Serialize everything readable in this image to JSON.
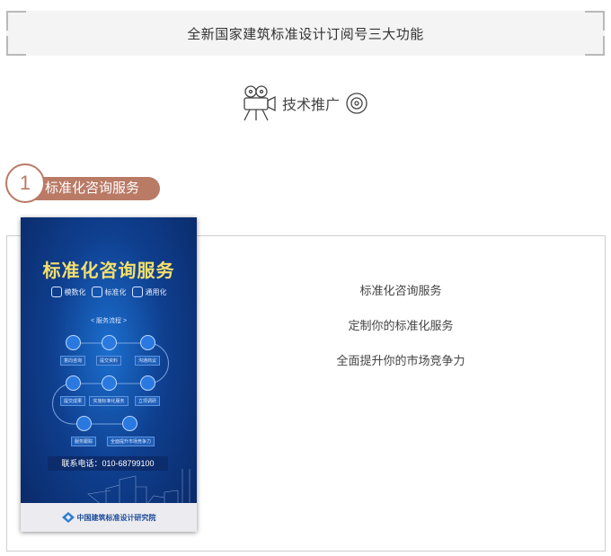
{
  "banner": {
    "title": "全新国家建筑标准设计订阅号三大功能"
  },
  "promo": {
    "label": "技术推广",
    "left_icon": "film-camera-icon",
    "right_icon": "disc-icon"
  },
  "section": {
    "number": "1",
    "title": "标准化咨询服务"
  },
  "card": {
    "lines": [
      "标准化咨询服务",
      "定制你的标准化服务",
      "全面提升你的市场竞争力"
    ]
  },
  "poster": {
    "title": "标准化咨询服务",
    "tags": [
      "模数化",
      "标准化",
      "通用化"
    ],
    "flow_label": "< 服务流程 >",
    "steps": [
      "意向咨询",
      "提交资料",
      "沟通商议",
      "立项调研",
      "实施标准化服务",
      "提交成果",
      "服务跟踪",
      "全面提升市场竞争力"
    ],
    "phone": "联系电话：010-68799100",
    "org": "中国建筑标准设计研究院"
  },
  "colors": {
    "accent": "#b97a66",
    "poster_blue": "#0f3f8f",
    "poster_title": "#f6e06a"
  }
}
